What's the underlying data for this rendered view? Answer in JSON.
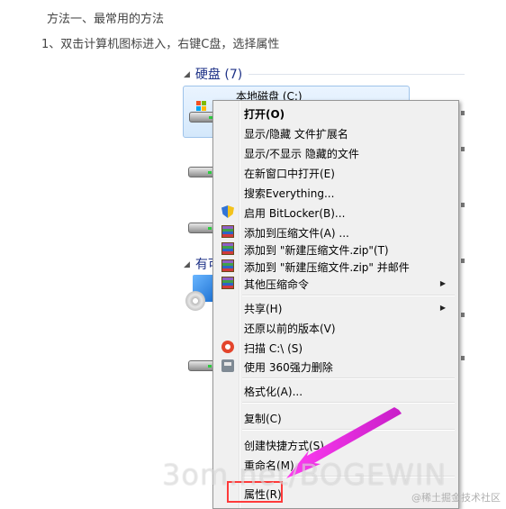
{
  "article": {
    "method_heading": "方法一、最常用的方法",
    "step1": "1、双击计算机图标进入，右键C盘，选择属性"
  },
  "explorer": {
    "hard_disks_header": "硬盘 (7)",
    "removable_header_partial": "有可",
    "selected_drive_label": "本地磁盘 (C:)"
  },
  "context_menu": {
    "items": [
      {
        "label": "打开(O)",
        "icon": "none",
        "bold": true
      },
      {
        "label": "显示/隐藏 文件扩展名",
        "icon": "none"
      },
      {
        "label": "显示/不显示 隐藏的文件",
        "icon": "none"
      },
      {
        "label": "在新窗口中打开(E)",
        "icon": "none"
      },
      {
        "label": "搜索Everything...",
        "icon": "none"
      },
      {
        "label": "启用 BitLocker(B)...",
        "icon": "shield-icon"
      },
      {
        "label": "添加到压缩文件(A) ...",
        "icon": "archive-icon"
      },
      {
        "label": "添加到 \"新建压缩文件.zip\"(T)",
        "icon": "archive-icon"
      },
      {
        "label": "添加到 \"新建压缩文件.zip\" 并邮件",
        "icon": "archive-icon"
      },
      {
        "label": "其他压缩命令",
        "icon": "archive-icon",
        "submenu": true
      },
      {
        "label": "共享(H)",
        "icon": "none",
        "submenu": true
      },
      {
        "label": "还原以前的版本(V)",
        "icon": "none"
      },
      {
        "label": "扫描 C:\\ (S)",
        "icon": "scan-icon"
      },
      {
        "label": "使用 360强力删除",
        "icon": "shredder-icon"
      },
      {
        "label": "格式化(A)...",
        "icon": "none"
      },
      {
        "label": "复制(C)",
        "icon": "none"
      },
      {
        "label": "创建快捷方式(S)",
        "icon": "none"
      },
      {
        "label": "重命名(M)",
        "icon": "none"
      },
      {
        "label": "属性(R)",
        "icon": "none"
      }
    ]
  },
  "overlay": {
    "watermark": "3om.net/BOGEWIN",
    "credit": "@稀土掘金技术社区",
    "highlight_color": "#ff3a3a",
    "arrow_color": "#e81ee8"
  }
}
